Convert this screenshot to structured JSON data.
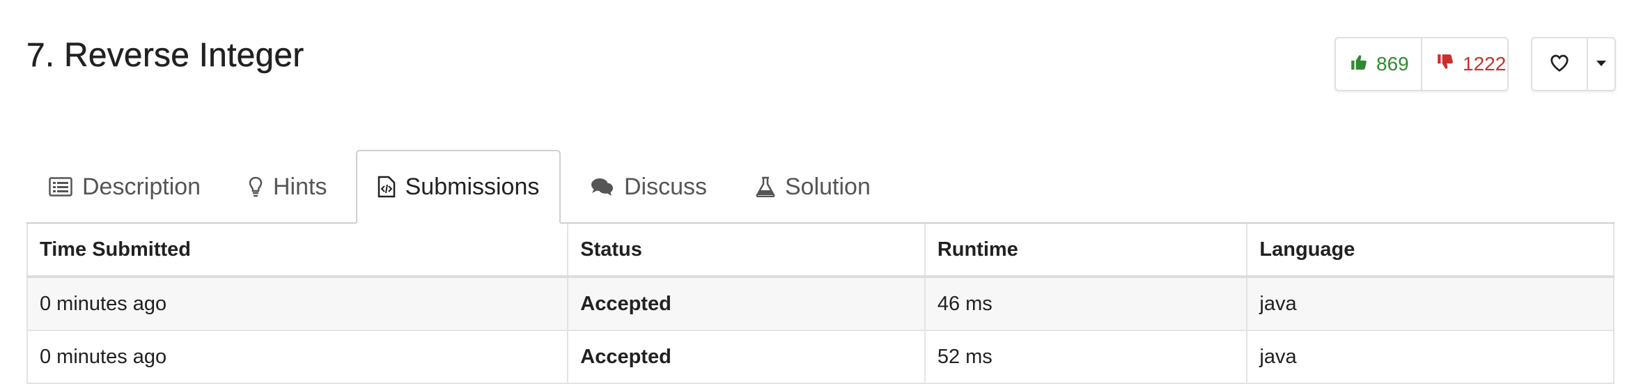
{
  "problem": {
    "title": "7. Reverse Integer"
  },
  "votes": {
    "likes": "869",
    "dislikes": "1222"
  },
  "icons": {
    "like": "thumbs-up-icon",
    "dislike": "thumbs-down-icon",
    "favorite": "heart-icon",
    "caret": "caret-down-icon"
  },
  "colors": {
    "accepted": "#2e8b2e",
    "like": "#2e8b2e",
    "dislike": "#c9302c"
  },
  "tabs": [
    {
      "label": "Description",
      "icon": "list-icon"
    },
    {
      "label": "Hints",
      "icon": "lightbulb-icon"
    },
    {
      "label": "Submissions",
      "icon": "code-file-icon",
      "active": true
    },
    {
      "label": "Discuss",
      "icon": "comments-icon"
    },
    {
      "label": "Solution",
      "icon": "flask-icon"
    }
  ],
  "table": {
    "headers": [
      "Time Submitted",
      "Status",
      "Runtime",
      "Language"
    ],
    "rows": [
      {
        "time": "0 minutes ago",
        "status": "Accepted",
        "runtime": "46 ms",
        "language": "java"
      },
      {
        "time": "0 minutes ago",
        "status": "Accepted",
        "runtime": "52 ms",
        "language": "java"
      }
    ]
  }
}
